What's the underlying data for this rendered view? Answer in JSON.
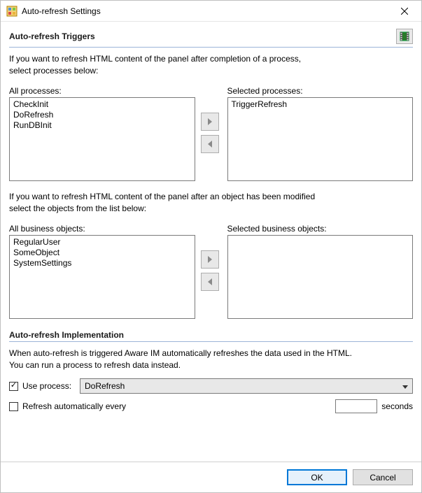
{
  "window": {
    "title": "Auto-refresh Settings"
  },
  "triggers": {
    "heading": "Auto-refresh Triggers",
    "desc_line1": "If you want to refresh HTML content of the panel after completion of a process,",
    "desc_line2": "select processes below:",
    "all_processes_label": "All processes:",
    "selected_processes_label": "Selected processes:",
    "all_processes": [
      "CheckInit",
      "DoRefresh",
      "RunDBInit"
    ],
    "selected_processes": [
      "TriggerRefresh"
    ],
    "desc2_line1": "If you want to refresh HTML content of the panel after an object has been modified",
    "desc2_line2": "select the objects from the list below:",
    "all_objects_label": "All business objects:",
    "selected_objects_label": "Selected business objects:",
    "all_objects": [
      "RegularUser",
      "SomeObject",
      "SystemSettings"
    ],
    "selected_objects": []
  },
  "impl": {
    "heading": "Auto-refresh Implementation",
    "desc_line1": "When auto-refresh is triggered Aware IM automatically refreshes the data used in the HTML.",
    "desc_line2": "You can run a process to refresh data instead.",
    "use_process_label": "Use process:",
    "use_process_checked": true,
    "use_process_value": "DoRefresh",
    "refresh_every_label": "Refresh automatically every",
    "refresh_every_checked": false,
    "refresh_every_value": "",
    "seconds_label": "seconds"
  },
  "footer": {
    "ok": "OK",
    "cancel": "Cancel"
  }
}
